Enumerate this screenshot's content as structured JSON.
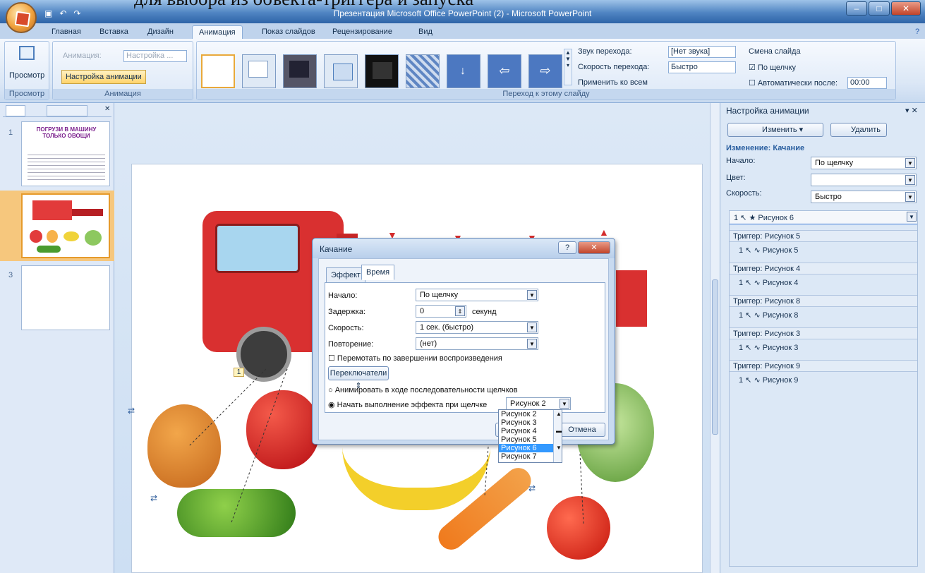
{
  "overlay_text": "для выбора из объекта-триггера и запуска",
  "window": {
    "title": "Презентация Microsoft Office PowerPoint (2) - Microsoft PowerPoint"
  },
  "tabs": [
    "Главная",
    "Вставка",
    "Дизайн",
    "Анимация",
    "Показ слайдов",
    "Рецензирование",
    "Вид"
  ],
  "ribbon": {
    "preview_label": "Просмотр",
    "animation_group_label": "Анимация",
    "preview_group_label": "Просмотр",
    "animation_label": "Анимация:",
    "animation_value": "Настройка ...",
    "custom_anim_button": "Настройка анимации",
    "transition_group_label": "Переход к этому слайду",
    "sound_label": "Звук перехода:",
    "sound_value": "[Нет звука]",
    "speed_label": "Скорость перехода:",
    "speed_value": "Быстро",
    "apply_all": "Применить ко всем",
    "advance_title": "Смена слайда",
    "on_click": "По щелчку",
    "auto_after": "Автоматически после:",
    "auto_time": "00:00"
  },
  "slides_pane": {
    "numbers": [
      "1",
      "2",
      "3"
    ],
    "slide1_title": "ПОГРУЗИ В МАШИНУ ТОЛЬКО ОВОЩИ"
  },
  "task_pane": {
    "title": "Настройка анимации",
    "change_button": "Изменить",
    "delete_button": "Удалить",
    "change_label": "Изменение: Качание",
    "start_label": "Начало:",
    "start_value": "По щелчку",
    "color_label": "Цвет:",
    "speed_label": "Скорость:",
    "speed_value": "Быстро",
    "selected_item": "Рисунок 6",
    "selected_num": "1",
    "triggers": [
      {
        "header": "Триггер: Рисунок 5",
        "num": "1",
        "item": "Рисунок 5"
      },
      {
        "header": "Триггер: Рисунок 4",
        "num": "1",
        "item": "Рисунок 4"
      },
      {
        "header": "Триггер: Рисунок 8",
        "num": "1",
        "item": "Рисунок 8"
      },
      {
        "header": "Триггер: Рисунок 3",
        "num": "1",
        "item": "Рисунок 3"
      },
      {
        "header": "Триггер: Рисунок 9",
        "num": "1",
        "item": "Рисунок 9"
      }
    ]
  },
  "dialog": {
    "title": "Качание",
    "tab_effect": "Эффект",
    "tab_time": "Время",
    "start_label": "Начало:",
    "start_value": "По щелчку",
    "delay_label": "Задержка:",
    "delay_value": "0",
    "delay_unit": "секунд",
    "speed_label": "Скорость:",
    "speed_value": "1 сек. (быстро)",
    "repeat_label": "Повторение:",
    "repeat_value": "(нет)",
    "rewind_label": "Перемотать по завершении воспроизведения",
    "switches_button": "Переключатели",
    "radio1": "Анимировать в ходе последовательности щелчков",
    "radio2": "Начать выполнение эффекта при щелчке",
    "trigger_value": "Рисунок 2",
    "cancel_button": "Отмена",
    "dropdown_options": [
      "Рисунок 2",
      "Рисунок 3",
      "Рисунок 4",
      "Рисунок 5",
      "Рисунок 6",
      "Рисунок 7"
    ],
    "dropdown_selected": "Рисунок 6"
  },
  "slide": {
    "order_tag": "1"
  }
}
